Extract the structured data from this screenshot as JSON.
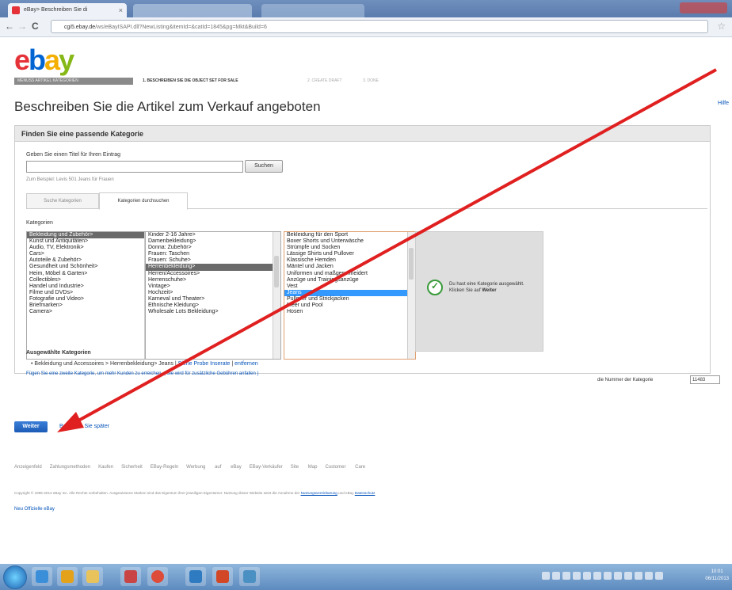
{
  "browser": {
    "tab_title": "eBay> Beschreiben Sie di",
    "tab_close": "×",
    "url_host": "cgi5.ebay.de",
    "url_path": "/ws/eBayISAPI.dll?NewListing&itemId=&catId=1845&pg=Mkt&Build=6",
    "back": "←",
    "forward": "→",
    "reload": "C",
    "star": "☆"
  },
  "ebay_logo": {
    "e": "e",
    "b": "b",
    "a": "a",
    "y": "y"
  },
  "progress_steps": [
    "MENUSS ARTIKEL KATEGORIEN",
    "1. BESCHREIBEN SIE DIE OBJECT SET FOR SALE",
    "2. CREATE DRAFT",
    "3. DONE"
  ],
  "page_title": "Beschreiben Sie die Artikel zum Verkauf angeboten",
  "help_link": "Hilfe",
  "panel": {
    "heading": "Finden Sie eine passende Kategorie",
    "title_label": "Geben Sie einen Titel für Ihren Eintrag",
    "title_value": "",
    "search_button": "Suchen",
    "example": "Zum Beispiel: Levis 501 Jeans für Frauen",
    "tab_search": "Suche Kategorien",
    "tab_browse": "Kategorien durchsuchen",
    "categories_label": "Kategorien",
    "list1": [
      "Bekleidung und Zubehör>",
      "Kunst und Antiquitäten>",
      "Audio, TV, Elektronik>",
      "Cars>",
      "Autoteile & Zubehör>",
      "Gesundheit und Schönheit>",
      "Heim, Möbel & Garten>",
      "Collectibles>",
      "Handel und Industrie>",
      "Filme und DVDs>",
      "Fotografie und Video>",
      "Briefmarken>",
      "Camera>"
    ],
    "list2": [
      "Kinder 2-16 Jahre>",
      "Damenbekleidung>",
      "Donna: Zubehör>",
      "Frauen: Taschen",
      "Frauen: Schuhe>",
      "Herrenbekleidung>",
      "Herren/Accessoires>",
      "Herrenschuhe>",
      "Vintage>",
      "Hochzeit>",
      "Karneval und Theater>",
      "Ethnische Kleidung>",
      "Wholesale Lots Bekleidung>"
    ],
    "list3": [
      "Bekleidung für den Sport",
      "Boxer Shorts und Unterwäsche",
      "Strümpfe und Socken",
      "Lässige Shirts und Pullover",
      "Klassische Hemden",
      "Mäntel und Jacken",
      "Uniformen und maßgeschneidert",
      "Anzüge und Trainingsanzüge",
      "Vest",
      "Jeans",
      "Pullover und Strickjacken",
      "Meer und Pool",
      "Hosen"
    ],
    "info_text": "Du hast eine Kategorie ausgewählt. Klicken Sie auf",
    "info_bold": "Weiter",
    "selected_heading": "Ausgewählte Kategorien",
    "selected_bullet": "•",
    "selected_path": "Bekleidung und Accessoires > Herrenbekleidung> Jeans",
    "selected_links_sep": "|",
    "selected_link1": "Siehe Probe Inserate",
    "selected_link2": "entfernen",
    "add_category": "Fügen Sie eine zweite Kategorie, um mehr Kunden zu erreichen. ( Sie wird für zusätzliche Gebühren anfallen )",
    "category_number_label": "die Nummer der Kategorie",
    "category_number": "11483"
  },
  "continue_button": "Weiter",
  "later_link": "Beginnen Sie später",
  "footer_links": [
    "Anzeigenfeld",
    "Zahlungsmethoden",
    "Kaufen",
    "Sicherheit",
    "EBay-Regeln",
    "Werbung auf eBay",
    "EBay-Verkäufer",
    "Site Map",
    "Customer Care"
  ],
  "copyright": "Copyright © 1995-2013 eBay Inc. Alle Rechte vorbehalten. Ausgewiesene Marken sind das Eigentum ihrer jeweiligen Eigentümer. Nutzung dieser Website setzt die Annahme der",
  "copyright_link1": "Nutzungsvereinbarung",
  "copyright_mid": "und eBay",
  "copyright_link2": "Datenschutz",
  "legacy_link": "Neu Offizielle eBay",
  "clock": {
    "time": "10:01",
    "date": "06/11/2013"
  },
  "colors": {
    "ebay_red": "#e53238",
    "ebay_blue": "#0064d2",
    "ebay_yellow": "#f5af02",
    "ebay_green": "#86b817",
    "arrow": "#e02020"
  }
}
